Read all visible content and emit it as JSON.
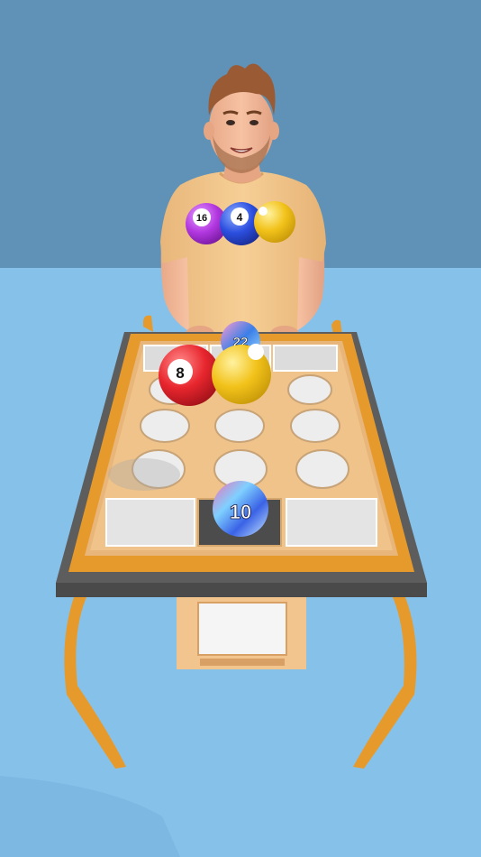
{
  "scene": {
    "wall_color": "#5f92b6",
    "floor_color": "#86c1ea",
    "table_color": "#e79a2c",
    "board_color": "#e8b67a"
  },
  "held_balls": [
    {
      "label": "16",
      "color": "#b238e0"
    },
    {
      "label": "4",
      "color": "#2c4fe0"
    },
    {
      "label": "",
      "color": "#f2c21a"
    }
  ],
  "board_balls": [
    {
      "label": "22",
      "color": "#3a7fe8"
    },
    {
      "label": "8",
      "color": "#e8262e"
    },
    {
      "label": "",
      "color": "#f2c21a"
    },
    {
      "label": "10",
      "color": "#6aa9f0"
    }
  ]
}
